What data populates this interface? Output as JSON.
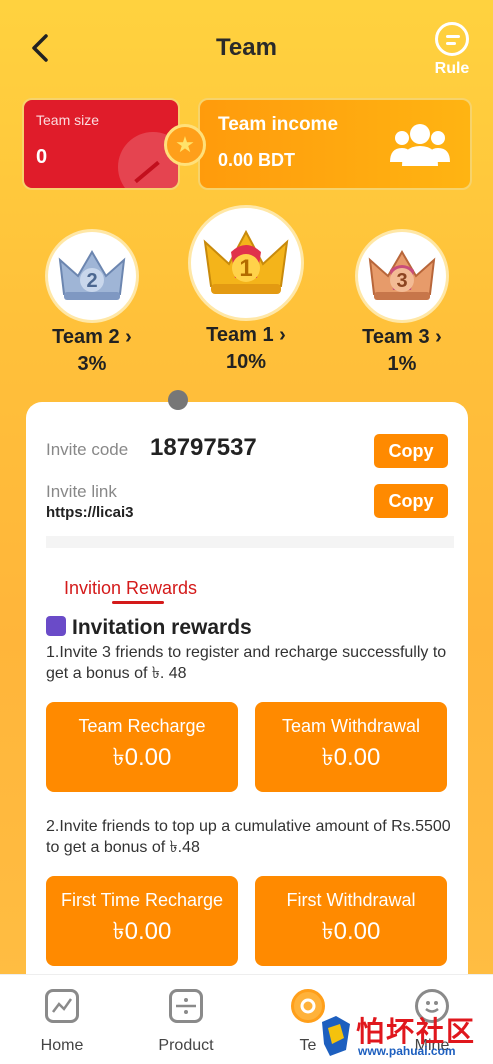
{
  "header": {
    "title": "Team",
    "rule_label": "Rule"
  },
  "stats": {
    "team_size_label": "Team size",
    "team_size_value": "0",
    "team_income_label": "Team income",
    "team_income_value": "0.00 BDT"
  },
  "tiers": [
    {
      "name": "Team 2",
      "chevron": "›",
      "percent": "3%",
      "crown_number": "2"
    },
    {
      "name": "Team 1",
      "chevron": "›",
      "percent": "10%",
      "crown_number": "1"
    },
    {
      "name": "Team 3",
      "chevron": "›",
      "percent": "1%",
      "crown_number": "3"
    }
  ],
  "invite": {
    "code_label": "Invite code",
    "code_value": "18797537",
    "link_label": "Invite link",
    "link_value": "https://licai3",
    "copy_label": "Copy"
  },
  "rewards": {
    "tab_label": "Invition Rewards",
    "section_title": "Invitation rewards",
    "rule1": "1.Invite 3 friends to register and recharge successfully to get a bonus of ৳. 48",
    "rule2": "2.Invite friends to top up a cumulative amount of Rs.5500 to get a bonus of ৳.48",
    "cards": [
      {
        "label": "Team Recharge",
        "value": "৳0.00"
      },
      {
        "label": "Team Withdrawal",
        "value": "৳0.00"
      },
      {
        "label": "First Time Recharge",
        "value": "৳0.00"
      },
      {
        "label": "First Withdrawal",
        "value": "৳0.00"
      }
    ]
  },
  "nav": [
    {
      "label": "Home",
      "icon": "chart-icon"
    },
    {
      "label": "Product",
      "icon": "product-icon"
    },
    {
      "label": "Te",
      "icon": "team-icon"
    },
    {
      "label": "Mine",
      "icon": "smile-icon"
    }
  ],
  "watermark": {
    "text": "怕坏社区",
    "url": "www.pahuai.com"
  },
  "colors": {
    "accent": "#ff8a00",
    "red_card": "#e01c2a",
    "tab_red": "#d41a1a"
  }
}
